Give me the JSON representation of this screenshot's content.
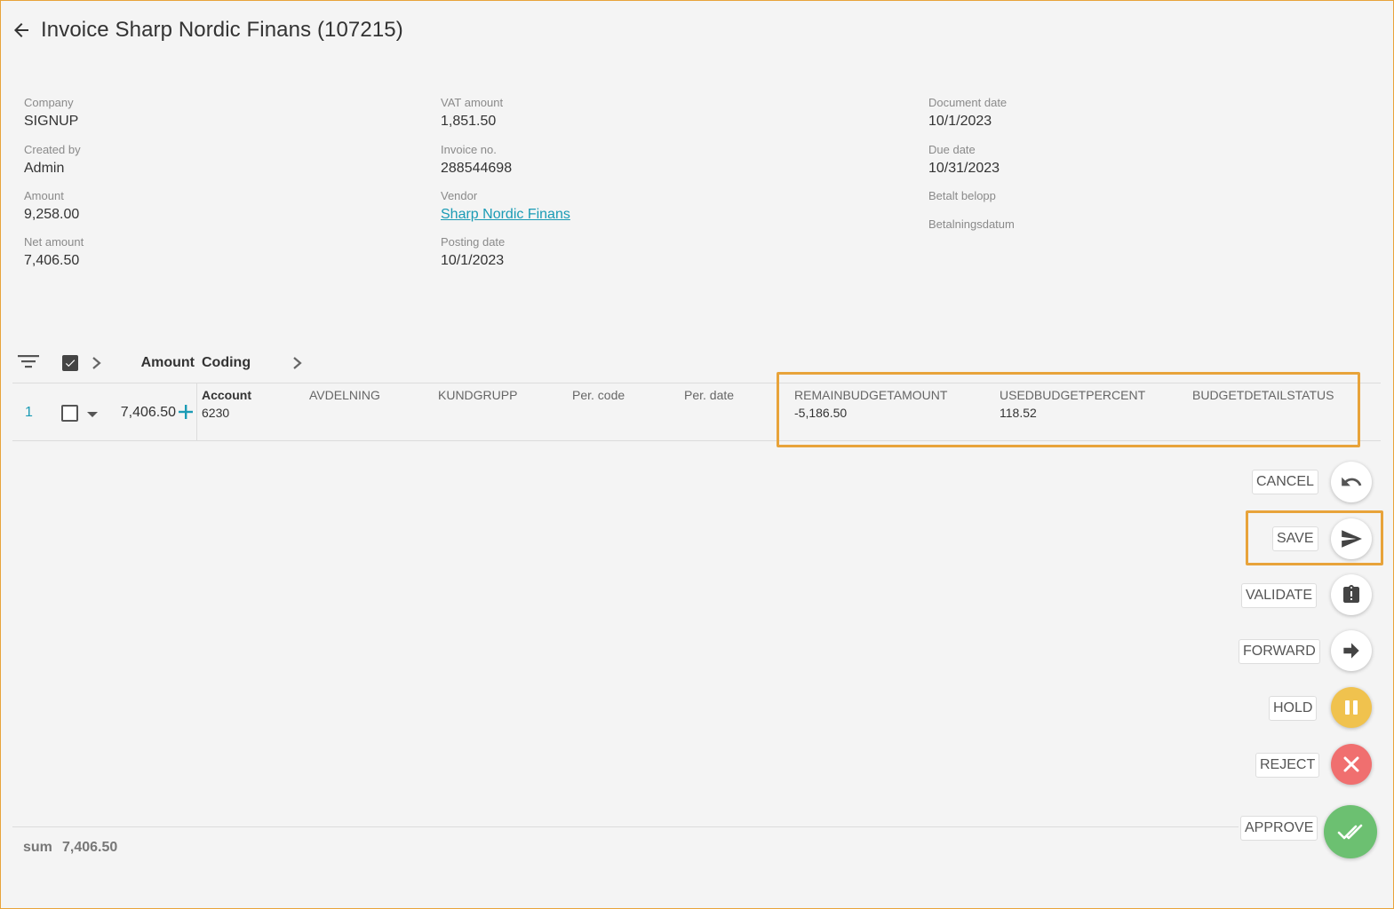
{
  "header": {
    "title": "Invoice Sharp Nordic Finans (107215)"
  },
  "fields": {
    "company": {
      "label": "Company",
      "value": "SIGNUP"
    },
    "created_by": {
      "label": "Created by",
      "value": "Admin"
    },
    "amount": {
      "label": "Amount",
      "value": "9,258.00"
    },
    "net_amount": {
      "label": "Net amount",
      "value": "7,406.50"
    },
    "vat_amount": {
      "label": "VAT amount",
      "value": "1,851.50"
    },
    "invoice_no": {
      "label": "Invoice no.",
      "value": "288544698"
    },
    "vendor": {
      "label": "Vendor",
      "value": "Sharp Nordic Finans"
    },
    "posting_date": {
      "label": "Posting date",
      "value": "10/1/2023"
    },
    "document_date": {
      "label": "Document date",
      "value": "10/1/2023"
    },
    "due_date": {
      "label": "Due date",
      "value": "10/31/2023"
    },
    "betalt_belopp": {
      "label": "Betalt belopp",
      "value": ""
    },
    "betalningsdatum": {
      "label": "Betalningsdatum",
      "value": ""
    }
  },
  "grid": {
    "headers": {
      "amount": "Amount",
      "coding": "Coding"
    },
    "row": {
      "number": "1",
      "amount": "7,406.50",
      "coding": {
        "account": {
          "label": "Account",
          "value": "6230"
        },
        "avdelning": {
          "label": "AVDELNING",
          "value": ""
        },
        "kundgrupp": {
          "label": "KUNDGRUPP",
          "value": ""
        },
        "per_code": {
          "label": "Per. code",
          "value": ""
        },
        "per_date": {
          "label": "Per. date",
          "value": ""
        },
        "remain_budget": {
          "label": "REMAINBUDGETAMOUNT",
          "value": "-5,186.50"
        },
        "used_budget": {
          "label": "USEDBUDGETPERCENT",
          "value": "118.52"
        },
        "budget_status": {
          "label": "BUDGETDETAILSTATUS",
          "value": ""
        }
      }
    }
  },
  "actions": {
    "cancel": "CANCEL",
    "save": "SAVE",
    "validate": "VALIDATE",
    "forward": "FORWARD",
    "hold": "HOLD",
    "reject": "REJECT",
    "approve": "APPROVE"
  },
  "footer": {
    "sum_label": "sum",
    "sum_value": "7,406.50"
  },
  "colors": {
    "highlight": "#e8a33a",
    "link": "#1a9bb5",
    "hold": "#f0c24e",
    "reject": "#f06f6f",
    "approve": "#6cc071"
  }
}
